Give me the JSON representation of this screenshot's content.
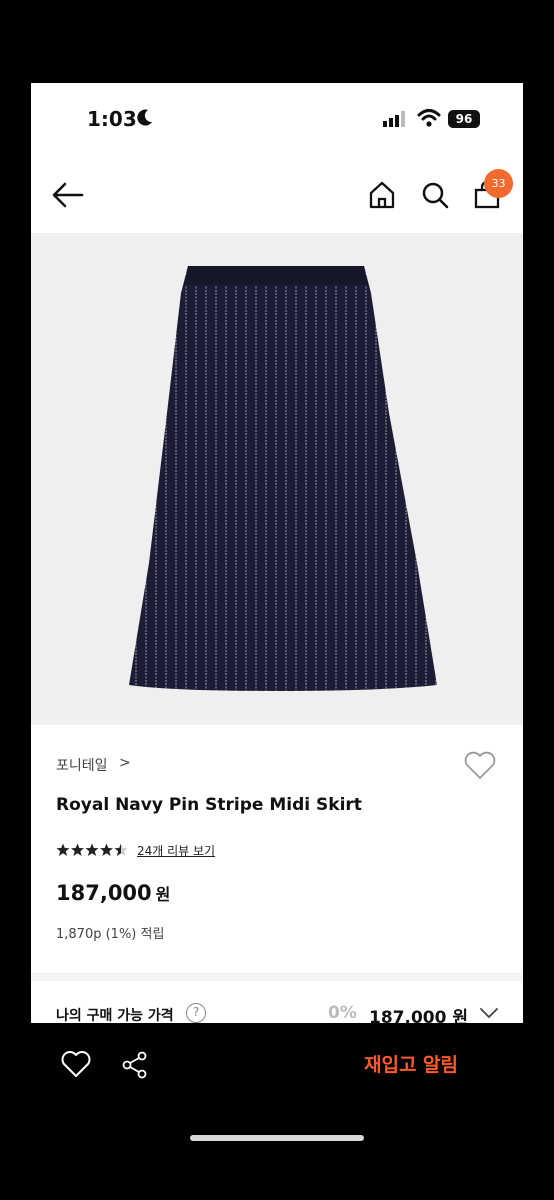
{
  "status_bar": {
    "time": "1:03",
    "battery": "96"
  },
  "nav": {
    "cart_count": "33"
  },
  "product": {
    "brand": "포니테일",
    "brand_chevron": ">",
    "name": "Royal Navy Pin Stripe Midi Skirt",
    "rating": 4.5,
    "review_link": "24개 리뷰 보기",
    "price": "187,000",
    "currency": "원",
    "points": "1,870p (1%) 적립",
    "image_colors": {
      "background": "#efefef",
      "fabric": "#1c1d35",
      "stripe": "#9a9bb0"
    }
  },
  "purchase": {
    "label": "나의 구매 가능 가격",
    "help": "?",
    "discount": "0%",
    "price": "187,000",
    "currency": "원"
  },
  "bottom_bar": {
    "restock_label": "재입고 알림",
    "accent": "#ff5a2a"
  }
}
